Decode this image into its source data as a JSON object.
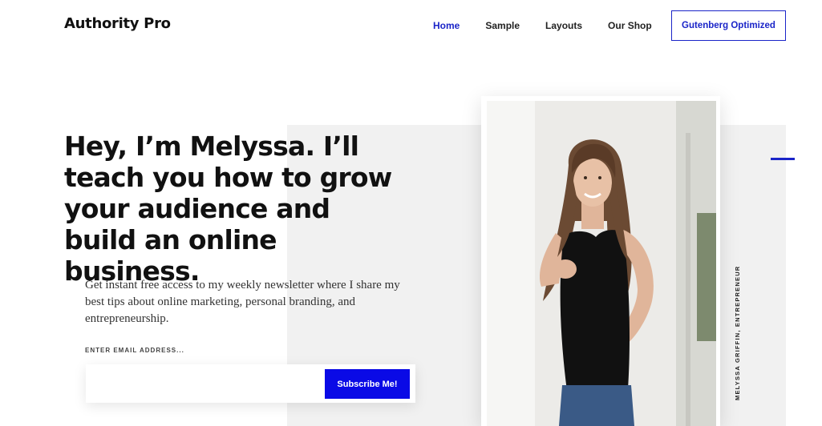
{
  "header": {
    "logo": "Authority Pro",
    "nav": [
      {
        "label": "Home",
        "active": true
      },
      {
        "label": "Sample"
      },
      {
        "label": "Layouts"
      },
      {
        "label": "Our Shop"
      }
    ],
    "cta_label": "Gutenberg Optimized"
  },
  "hero": {
    "heading": "Hey, I’m Melyssa. I’ll teach you how to grow your audience and build an online business.",
    "description": "Get instant free access to my weekly newsletter where I share my best tips about online marketing, personal branding, and entrepreneurship.",
    "email_label": "ENTER EMAIL ADDRESS...",
    "email_value": "",
    "subscribe_label": "Subscribe Me!"
  },
  "photo": {
    "caption": "MELYSSA GRIFFIN, ENTREPRENEUR"
  },
  "colors": {
    "accent": "#1a24c8",
    "button": "#0a0ae6",
    "band": "#f1f1f1"
  }
}
